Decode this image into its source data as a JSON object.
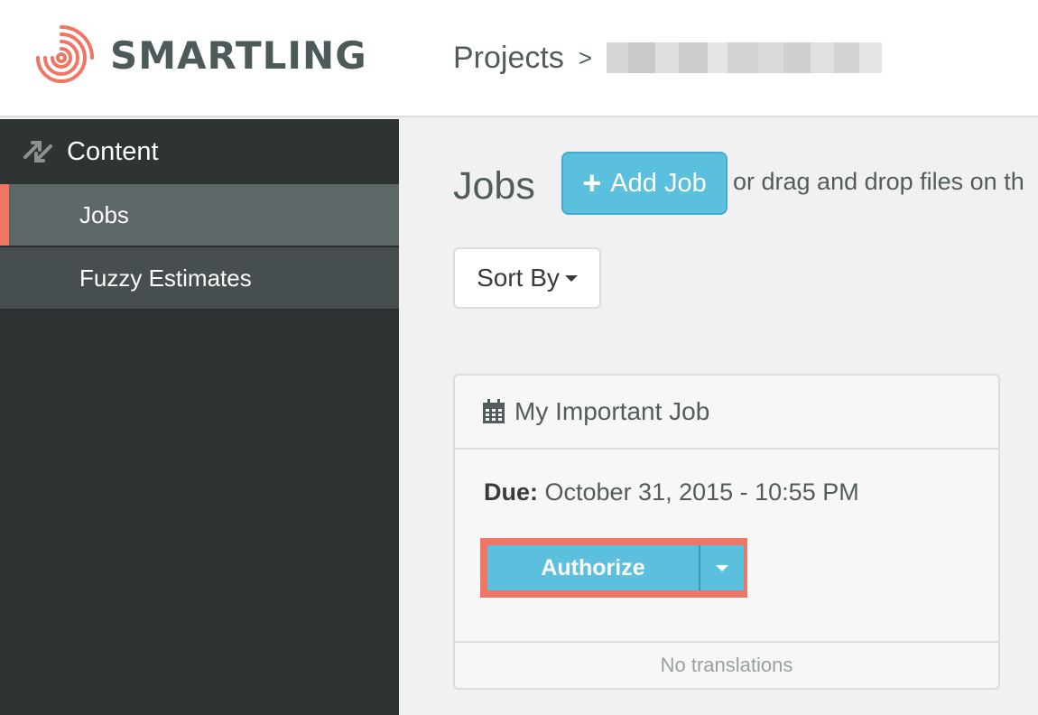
{
  "header": {
    "brand": "SMARTLING",
    "breadcrumb_root": "Projects",
    "breadcrumb_separator": ">"
  },
  "sidebar": {
    "section_title": "Content",
    "items": [
      {
        "label": "Jobs",
        "active": true
      },
      {
        "label": "Fuzzy Estimates",
        "active": false
      }
    ]
  },
  "main": {
    "title": "Jobs",
    "add_job_label": "Add Job",
    "drag_text": "or drag and drop files on th",
    "sort_label": "Sort By"
  },
  "job_card": {
    "name": "My Important Job",
    "due_label": "Due:",
    "due_value": "October 31, 2015 - 10:55 PM",
    "authorize_label": "Authorize",
    "footer_text": "No translations"
  },
  "colors": {
    "brand_accent": "#ef7564",
    "primary_button": "#5bc0de",
    "sidebar_bg": "#2e3334",
    "sidebar_active": "#5d6767"
  },
  "icons": {
    "logo": "smartling-fingerprint-icon",
    "content": "content-arrows-icon",
    "add": "plus-icon",
    "calendar": "calendar-icon",
    "dropdown": "caret-down-icon"
  }
}
